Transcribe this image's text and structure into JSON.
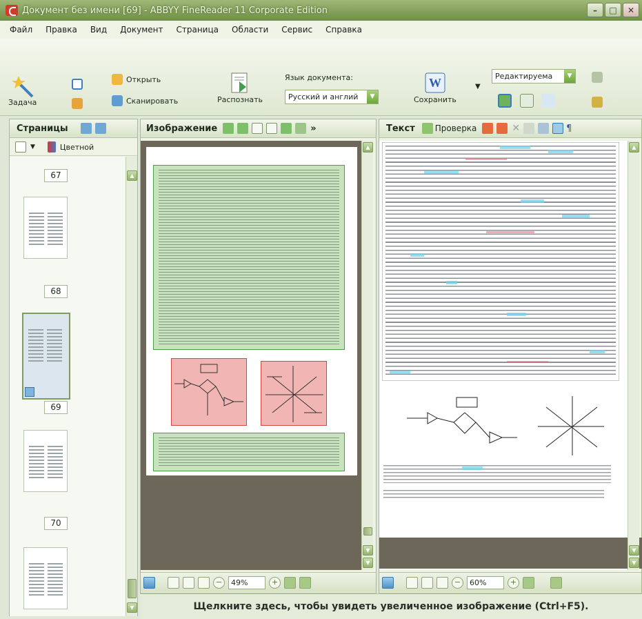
{
  "window": {
    "title": "Документ без имени [69] - ABBYY FineReader 11 Corporate Edition"
  },
  "menu": [
    "Файл",
    "Правка",
    "Вид",
    "Документ",
    "Страница",
    "Области",
    "Сервис",
    "Справка"
  ],
  "toolbar": {
    "task_label": "Задача",
    "open_label": "Открыть",
    "scan_label": "Сканировать",
    "recognize_label": "Распознать",
    "doc_language_label": "Язык документа:",
    "doc_language_value": "Русский и англий",
    "save_label": "Сохранить",
    "save_mode_value": "Редактируема"
  },
  "pages_panel": {
    "title": "Страницы",
    "color_mode": "Цветной",
    "page_numbers": [
      "67",
      "68",
      "69",
      "70"
    ],
    "selected_page": "69"
  },
  "image_panel": {
    "title": "Изображение",
    "zoom": "49%"
  },
  "text_panel": {
    "title": "Текст",
    "check_label": "Проверка",
    "zoom": "60%"
  },
  "status": {
    "hint": "Щелкните здесь, чтобы увидеть увеличенное изображение (Ctrl+F5)."
  },
  "colors": {
    "titlebar": "#7f9d55",
    "text_zone": "#c6e3bd",
    "picture_zone": "#f1b6b3",
    "highlight": "#6fd6e8"
  }
}
